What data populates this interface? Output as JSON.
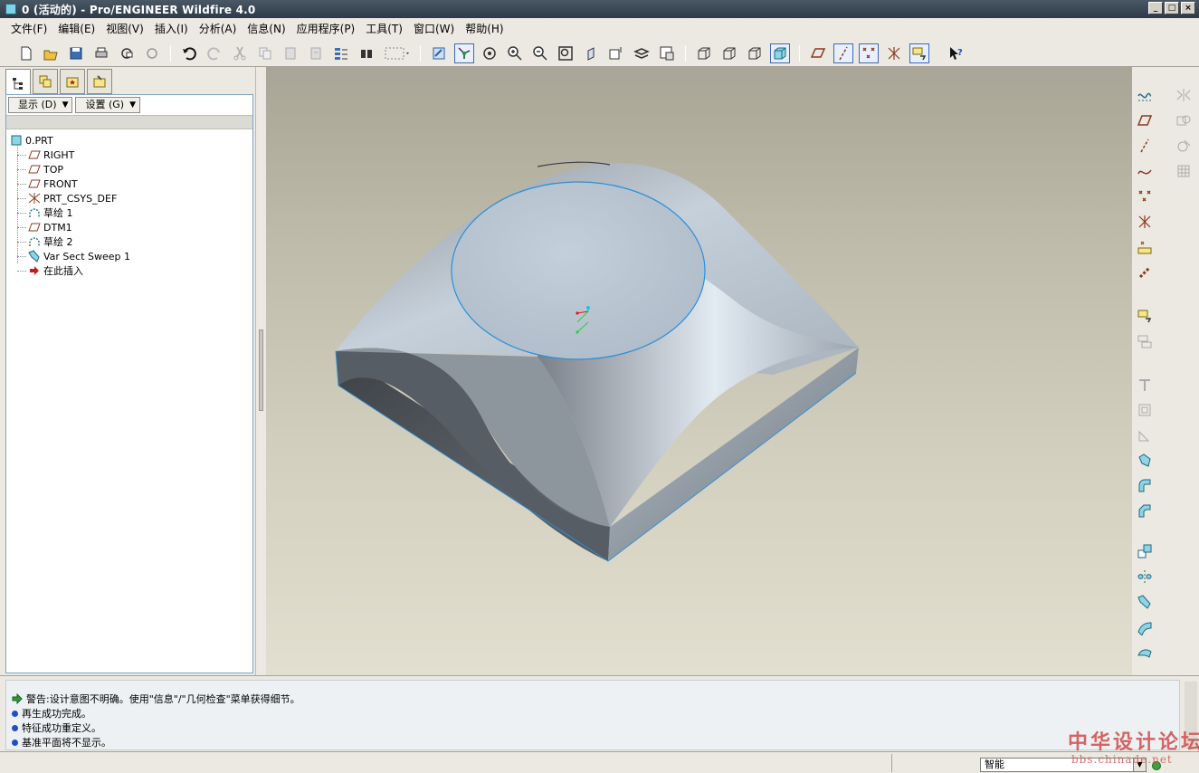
{
  "window": {
    "title": "0 (活动的) - Pro/ENGINEER Wildfire 4.0",
    "minimize": "_",
    "maximize": "□",
    "close": "×"
  },
  "menu": {
    "items": [
      "文件(F)",
      "编辑(E)",
      "视图(V)",
      "插入(I)",
      "分析(A)",
      "信息(N)",
      "应用程序(P)",
      "工具(T)",
      "窗口(W)",
      "帮助(H)"
    ]
  },
  "toolbar": {
    "icons": [
      "new-icon",
      "open-icon",
      "save-icon",
      "print-icon",
      "send-mail-icon",
      "send-mail-attach-icon",
      "undo-icon",
      "redo-icon",
      "cut-icon",
      "copy-icon",
      "paste-icon",
      "paste-special-icon",
      "regenerate-icon",
      "find-icon",
      "selection-box-icon",
      "repaint-icon",
      "spin-center-icon",
      "orient-mode-icon",
      "zoom-in-icon",
      "zoom-out-icon",
      "refit-icon",
      "reorient-icon",
      "saved-views-icon",
      "layers-icon",
      "view-manager-icon",
      "wireframe-icon",
      "hidden-line-icon",
      "no-hidden-icon",
      "shading-icon",
      "datum-planes-icon",
      "datum-axes-icon",
      "datum-points-icon",
      "coordinate-systems-icon",
      "annotations-icon",
      "context-help-icon"
    ]
  },
  "navigator": {
    "tabs": [
      "model-tree-tab",
      "layer-tree-tab",
      "favorites-tab",
      "connections-tab"
    ],
    "show_button": "显示 (D)",
    "settings_button": "设置 (G)",
    "tree": [
      {
        "label": "0.PRT",
        "icon": "part-icon",
        "level": 0
      },
      {
        "label": "RIGHT",
        "icon": "datum-plane-icon",
        "level": 1
      },
      {
        "label": "TOP",
        "icon": "datum-plane-icon",
        "level": 1
      },
      {
        "label": "FRONT",
        "icon": "datum-plane-icon",
        "level": 1
      },
      {
        "label": "PRT_CSYS_DEF",
        "icon": "csys-icon",
        "level": 1
      },
      {
        "label": "草绘 1",
        "icon": "sketch-icon",
        "level": 1
      },
      {
        "label": "DTM1",
        "icon": "datum-plane-icon",
        "level": 1
      },
      {
        "label": "草绘 2",
        "icon": "sketch-icon",
        "level": 1
      },
      {
        "label": "Var Sect Sweep 1",
        "icon": "sweep-icon",
        "level": 1
      },
      {
        "label": "在此插入",
        "icon": "insert-here-icon",
        "level": 1
      }
    ]
  },
  "messages": [
    {
      "type": "warning",
      "text": "警告:设计意图不明确。使用\"信息\"/\"几何检查\"菜单获得细节。"
    },
    {
      "type": "info",
      "text": "再生成功完成。"
    },
    {
      "type": "info",
      "text": "特征成功重定义。"
    },
    {
      "type": "info",
      "text": "基准平面将不显示。"
    }
  ],
  "status": {
    "filter_value": "智能",
    "watermark_title": "中华设计论坛",
    "watermark_url": "bbs.chinade.net"
  },
  "right_toolbar": {
    "icons": [
      "sketch-tool-icon",
      "datum-plane-tool-icon",
      "datum-axis-tool-icon",
      "datum-curve-tool-icon",
      "datum-point-tool-icon",
      "datum-csys-tool-icon",
      "analysis-feature-icon",
      "chain-icon",
      "annotation-feature-icon",
      "copy-geometry-icon",
      "hole-icon",
      "shell-icon",
      "rib-icon",
      "draft-icon",
      "round-icon",
      "chamfer-icon",
      "pattern-icon",
      "mirror-icon",
      "sweep-tool-icon",
      "boundary-blend-icon",
      "style-icon",
      "mirror-tool-icon",
      "merge-icon",
      "trim-icon",
      "array-icon"
    ]
  }
}
